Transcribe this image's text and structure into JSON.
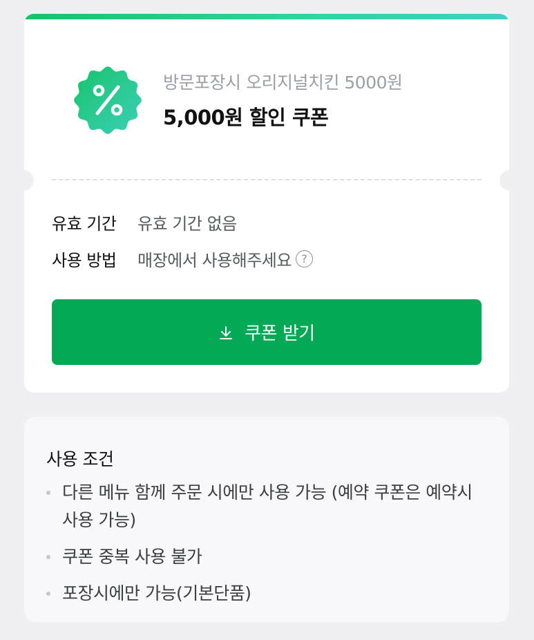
{
  "coupon": {
    "subtitle": "방문포장시 오리지널치킨 5000원",
    "title": "5,000원 할인 쿠폰",
    "badge_icon": "percent-badge-icon",
    "accent_color": "#04a955"
  },
  "info": {
    "validity_label": "유효 기간",
    "validity_value": "유효 기간 없음",
    "usage_label": "사용 방법",
    "usage_value": "매장에서 사용해주세요",
    "help_icon": "?"
  },
  "download_button": {
    "label": "쿠폰 받기",
    "icon": "download-icon"
  },
  "conditions": {
    "title": "사용 조건",
    "items": [
      "다른 메뉴 함께 주문 시에만 사용 가능 (예약 쿠폰은 예약시 사용 가능)",
      "쿠폰 중복 사용 불가",
      "포장시에만 가능(기본단품)"
    ]
  }
}
